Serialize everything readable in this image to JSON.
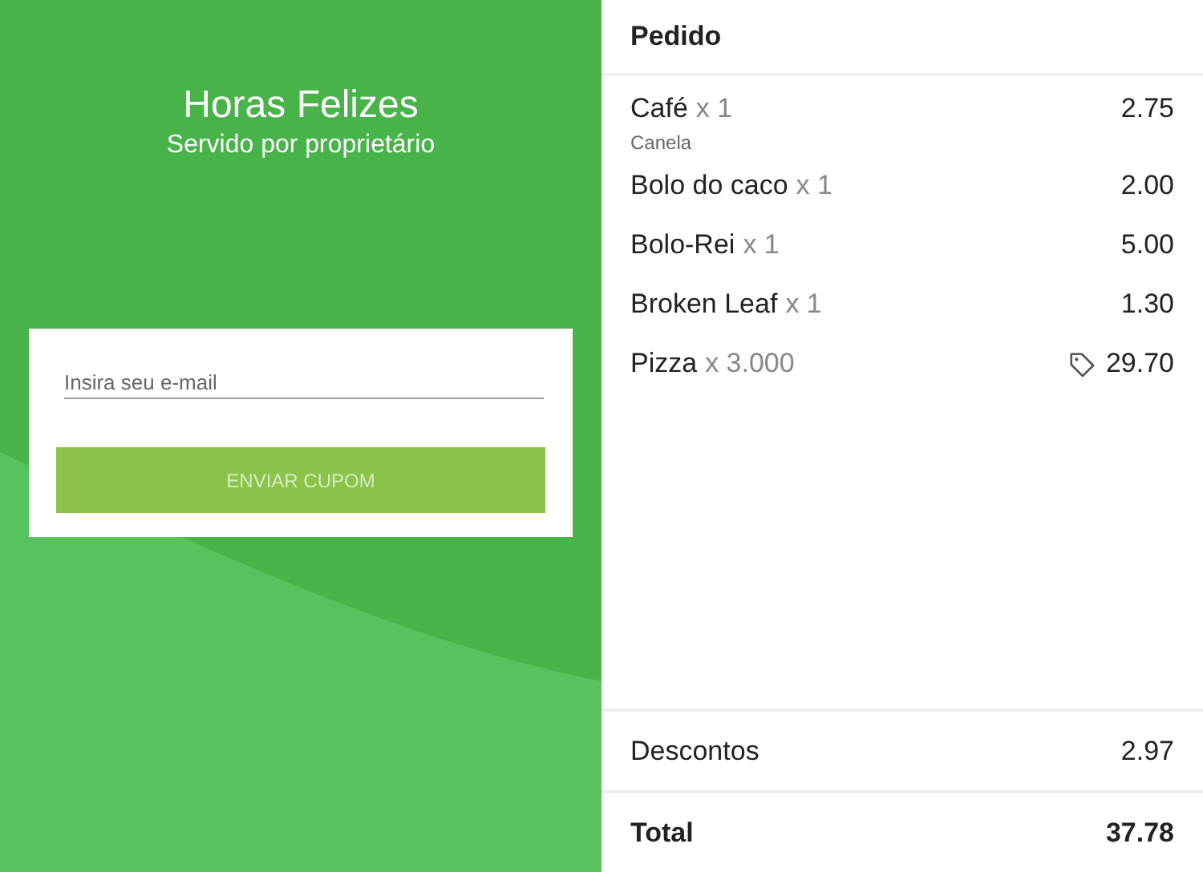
{
  "promo": {
    "title": "Horas Felizes",
    "subtitle": "Servido por proprietário",
    "email_field": {
      "placeholder": "Insira seu e-mail"
    },
    "button": {
      "label": "ENVIAR CUPOM",
      "disabled": true
    }
  },
  "order": {
    "title": "Pedido",
    "items": [
      {
        "name": "Café",
        "quantity": "x 1",
        "note": "Canela",
        "price": "2.75",
        "discounted": false
      },
      {
        "name": "Bolo do caco",
        "quantity": "x 1",
        "price": "2.00",
        "discounted": false
      },
      {
        "name": "Bolo-Rei",
        "quantity": "x 1",
        "price": "5.00",
        "discounted": false
      },
      {
        "name": "Broken Leaf",
        "quantity": "x 1",
        "price": "1.30",
        "discounted": false
      },
      {
        "name": "Pizza",
        "quantity": "x 3.000",
        "price": "29.70",
        "discounted": true
      }
    ],
    "discounts": {
      "label": "Descontos",
      "value": "2.97"
    },
    "total": {
      "label": "Total",
      "value": "37.78"
    }
  }
}
